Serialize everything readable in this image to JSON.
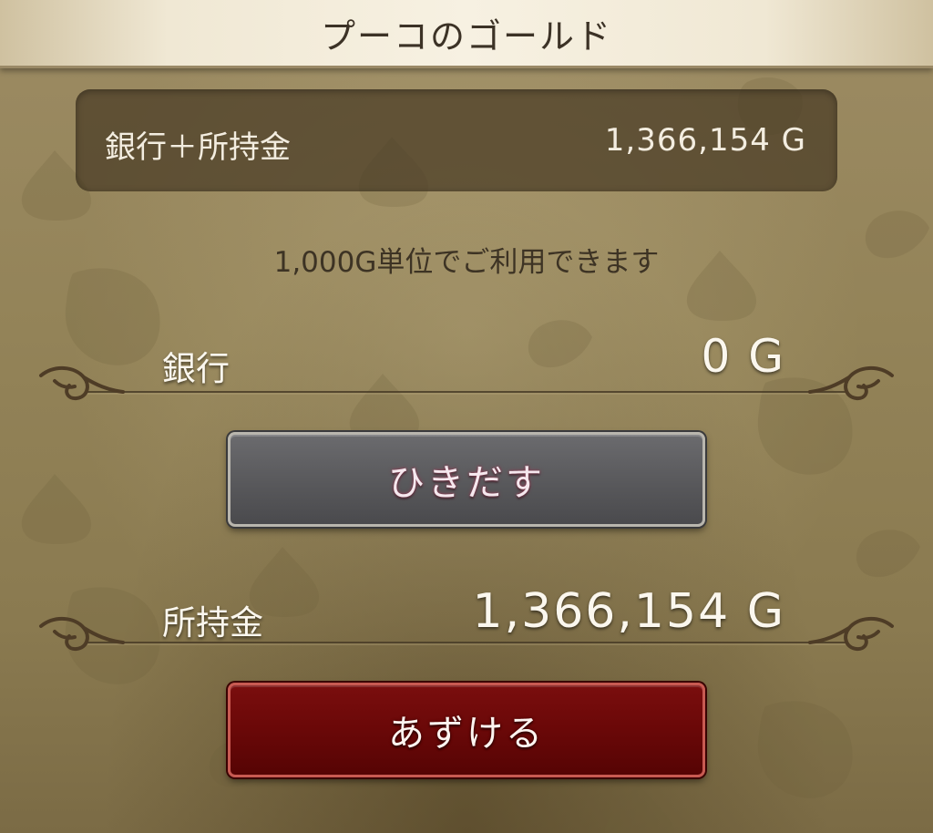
{
  "header": {
    "title": "プーコのゴールド"
  },
  "summary": {
    "label": "銀行＋所持金",
    "value": "1,366,154 G"
  },
  "notice": "1,000G単位でご利用できます",
  "bank": {
    "label": "銀行",
    "value": "0 G"
  },
  "wallet": {
    "label": "所持金",
    "value": "1,366,154 G"
  },
  "buttons": {
    "withdraw": "ひきだす",
    "deposit": "あずける"
  },
  "colors": {
    "withdraw_button": "#5a5a5d",
    "deposit_button": "#6a0808",
    "title_bar": "#f4eddc",
    "panel": "#483a24"
  }
}
